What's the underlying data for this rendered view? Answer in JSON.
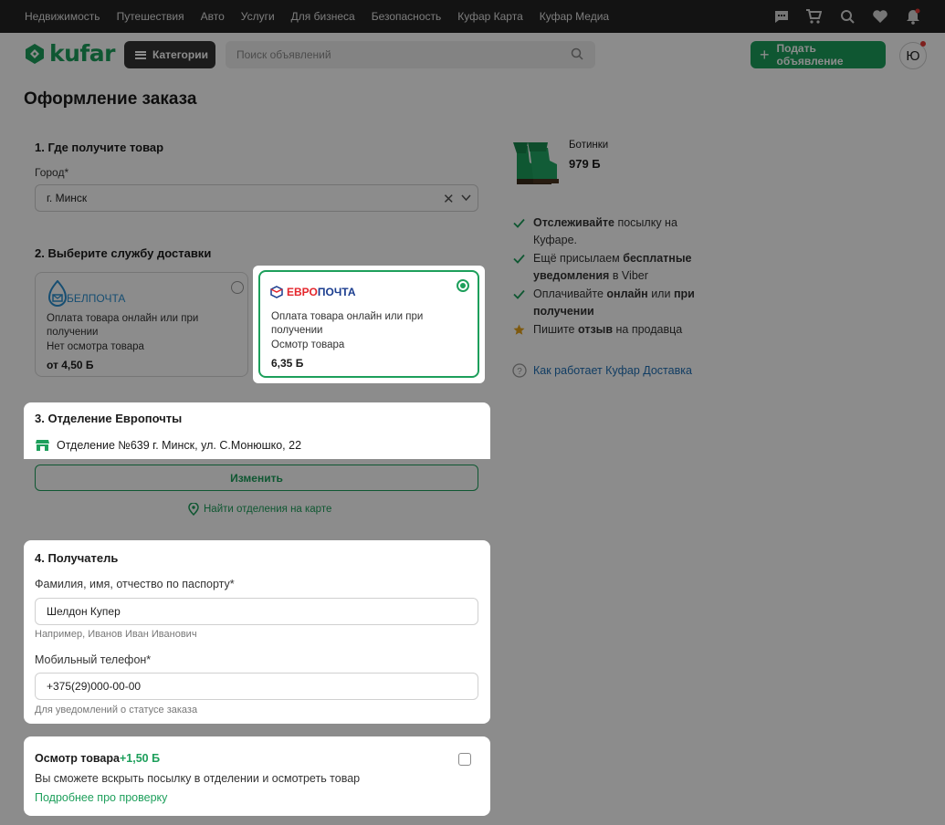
{
  "topbar": {
    "links": [
      "Недвижимость",
      "Путешествия",
      "Авто",
      "Услуги",
      "Для бизнеса",
      "Безопасность",
      "Куфар Карта",
      "Куфар Медиа"
    ],
    "icons": [
      "chat-icon",
      "cart-icon",
      "heart-search-icon",
      "heart-icon",
      "bell-icon"
    ]
  },
  "header": {
    "logo": "kufar",
    "categories_label": "Категории",
    "search_placeholder": "Поиск объявлений",
    "post_label": "Подать объявление",
    "avatar_letter": "Ю"
  },
  "page": {
    "title": "Оформление заказа"
  },
  "step1": {
    "title": "1. Где получите товар",
    "city_label": "Город*",
    "city_value": "г. Минск"
  },
  "step2": {
    "title": "2. Выберите службу доставки",
    "options": [
      {
        "logo": "БЕЛПОЧТА",
        "payment": "Оплата товара онлайн или при получении",
        "inspection": "Нет осмотра товара",
        "price": "от 4,50 Б",
        "selected": false
      },
      {
        "logo_red": "ЕВРО",
        "logo_blue": "ПОЧТА",
        "payment": "Оплата товара онлайн или при получении",
        "inspection": "Осмотр товара",
        "price": "6,35 Б",
        "selected": true
      }
    ]
  },
  "step3": {
    "title": "3. Отделение Европочты",
    "office": "Отделение №639 г. Минск, ул. С.Монюшко, 22",
    "change_label": "Изменить",
    "map_link": "Найти отделения на карте"
  },
  "step4": {
    "title": "4. Получатель",
    "name_label": "Фамилия, имя, отчество по паспорту*",
    "name_value": "Шелдон Купер",
    "name_hint": "Например, Иванов Иван Иванович",
    "phone_label": "Мобильный телефон*",
    "phone_value": "+375(29)000-00-00",
    "phone_hint": "Для уведомлений о статусе заказа"
  },
  "inspection": {
    "title": "Осмотр товара",
    "price": "+1,50 Б",
    "description": "Вы сможете вскрыть посылку в отделении и осмотреть товар",
    "link": "Подробнее про проверку",
    "checked": false
  },
  "product": {
    "name": "Ботинки",
    "price": "979 Б"
  },
  "benefits": [
    {
      "icon": "check-icon",
      "parts": [
        {
          "b": "Отслеживайте"
        },
        {
          "t": " посылку на"
        }
      ],
      "line2": "Куфаре."
    },
    {
      "icon": "check-icon",
      "line1a": "Ещё присылаем ",
      "line1b": "бесплатные",
      "line2b": "уведомления",
      "line2a": " в Viber"
    },
    {
      "icon": "check-icon",
      "line1a": "Оплачивайте ",
      "line1b": "онлайн",
      "line1c": " или ",
      "line1d": "при",
      "line2b": "получении"
    },
    {
      "icon": "star-icon",
      "line1a": "Пишите ",
      "line1b": "отзыв",
      "line1c": " на продавца"
    }
  ],
  "help_link": "Как работает Куфар Доставка",
  "colors": {
    "brand": "#1d9f5b",
    "topbar": "#232323",
    "euro_red": "#e4262c",
    "euro_blue": "#1b3d8f",
    "bel_blue": "#2a8fd0"
  }
}
